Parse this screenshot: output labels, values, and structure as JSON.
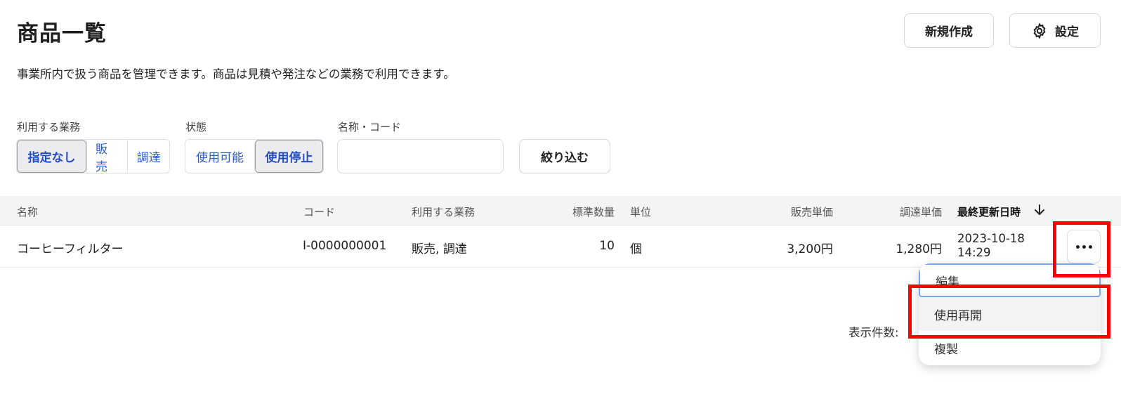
{
  "header": {
    "title": "商品一覧",
    "description": "事業所内で扱う商品を管理できます。商品は見積や発注などの業務で利用できます。",
    "new_label": "新規作成",
    "settings_label": "設定",
    "settings_icon": "gear-icon"
  },
  "filters": {
    "business_label": "利用する業務",
    "business_options": [
      "指定なし",
      "販売",
      "調達"
    ],
    "business_selected": "指定なし",
    "status_label": "状態",
    "status_options": [
      "使用可能",
      "使用停止"
    ],
    "status_selected": "使用停止",
    "name_code_label": "名称・コード",
    "name_code_value": "",
    "search_icon": "search-icon",
    "filter_button": "絞り込む"
  },
  "table": {
    "columns": [
      "名称",
      "コード",
      "利用する業務",
      "標準数量",
      "単位",
      "販売単価",
      "調達単価",
      "最終更新日時"
    ],
    "sort_column": "最終更新日時",
    "sort_direction": "desc",
    "rows": [
      {
        "name": "コーヒーフィルター",
        "code": "I-0000000001",
        "business": "販売, 調達",
        "std_qty": "10",
        "unit": "個",
        "sale_price": "3,200円",
        "purchase_price": "1,280円",
        "updated": "2023-10-18 14:29"
      }
    ]
  },
  "footer": {
    "page_size_label": "表示件数:"
  },
  "context_menu": {
    "items": [
      "編集",
      "使用再開",
      "複製"
    ],
    "hovered": "使用再開"
  },
  "colors": {
    "link_blue": "#2f5bd0",
    "highlight_red": "#ff0000",
    "focus_blue": "#7aa5f3"
  }
}
